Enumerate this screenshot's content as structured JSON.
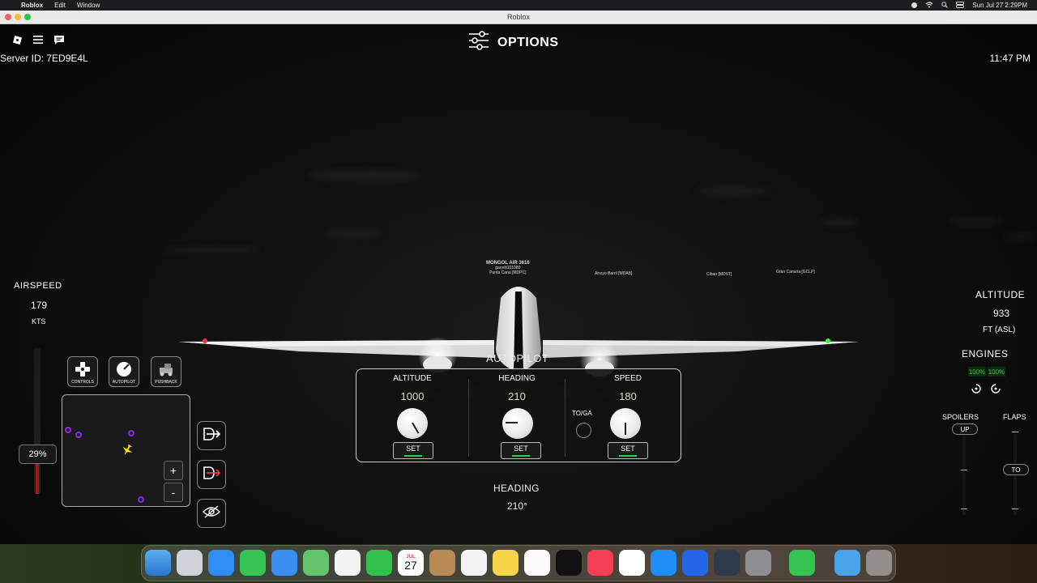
{
  "menubar": {
    "app": "Roblox",
    "items": [
      "Edit",
      "Window"
    ],
    "datetime": "Sun Jul 27  2:29PM"
  },
  "window": {
    "title": "Roblox"
  },
  "hud": {
    "options_label": "OPTIONS",
    "server_id": "Server ID: 7ED9E4L",
    "game_time": "11:47 PM"
  },
  "plane_tags": {
    "callsign": "MONGOL AIR 3616",
    "player": "garrett101080",
    "origin": "Punta Cana [MDPC]",
    "tag2": "Arroyo Barril [MDAB]",
    "tag3": "Cibao [MDST]",
    "tag4": "Gran Canaria [GCLP]"
  },
  "airspeed": {
    "label": "AIRSPEED",
    "value": "179",
    "unit": "KTS"
  },
  "throttle": {
    "percent_label": "29%",
    "level": 0.29
  },
  "quick_buttons": [
    {
      "label": "CONTROLS",
      "icon": "controls-icon"
    },
    {
      "label": "AUTOPILOT",
      "icon": "autopilot-icon"
    },
    {
      "label": "PUSHBACK",
      "icon": "pushback-icon"
    }
  ],
  "map": {
    "zoom_in": "+",
    "zoom_out": "-"
  },
  "autopilot": {
    "title": "AUTOPILOT",
    "altitude": {
      "label": "ALTITUDE",
      "value": "1000",
      "set": "SET"
    },
    "heading": {
      "label": "HEADING",
      "value": "210",
      "set": "SET"
    },
    "speed": {
      "label": "SPEED",
      "value": "180",
      "set": "SET"
    },
    "toga": "TO/GA"
  },
  "heading_readout": {
    "label": "HEADING",
    "value": "210°"
  },
  "altitude": {
    "label": "ALTITUDE",
    "value": "933",
    "unit": "FT (ASL)"
  },
  "engines": {
    "label": "ENGINES",
    "left": "100%",
    "right": "100%"
  },
  "spoilers": {
    "label": "SPOILERS",
    "state": "UP"
  },
  "flaps": {
    "label": "FLAPS",
    "state": "TO"
  },
  "colors": {
    "accent_green": "#2ecc40",
    "nav_red": "#ff3030",
    "nav_green": "#30ff30",
    "pin_purple": "#8a2be2"
  },
  "dock": [
    "Finder",
    "Launchpad",
    "Safari",
    "Messages",
    "Mail",
    "Maps",
    "Photos",
    "FaceTime",
    "Calendar",
    "Contacts",
    "Reminders",
    "Notes",
    "Freeform",
    "TV",
    "Music",
    "News",
    "App Store",
    "Roblox",
    "QuickTime",
    "System Settings",
    "Screen Sharing",
    "Downloads",
    "Trash"
  ],
  "calendar": {
    "month": "JUL",
    "day": "27"
  }
}
